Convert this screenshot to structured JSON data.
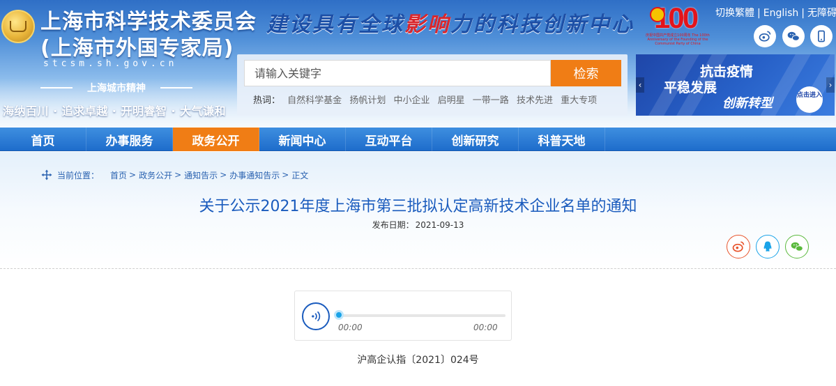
{
  "header": {
    "site_title": "上海市科学技术委员会",
    "site_subtitle": "(上海市外国专家局)",
    "domain": "stcsm.sh.gov.cn",
    "spirit_label": "上海城市精神",
    "spirit_text": "海纳百川 · 追求卓越 · 开明睿智 · 大气谦和",
    "slogan_a": "建设具有全球",
    "slogan_hl": "影响",
    "slogan_b": "力的科技创新中心",
    "anniversary_number": "100",
    "anniversary_caption": "庆祝中国共产党成立100周年 The 100th Anniversary of the Founding of the Communist Party of China",
    "top_links": [
      "切换繁體",
      "English",
      "无障碍"
    ],
    "social_icons": [
      "weibo-icon",
      "wechat-icon"
    ]
  },
  "search": {
    "placeholder": "请输入关键字",
    "button_label": "检索",
    "hot_label": "热词：",
    "hot_terms": [
      "自然科学基金",
      "扬帆计划",
      "中小企业",
      "启明星",
      "一带一路",
      "技术先进",
      "重大专项"
    ]
  },
  "banner": {
    "line1": "抗击疫情",
    "line2": "平稳发展",
    "line3": "创新转型",
    "enter_label": "点击进入"
  },
  "nav": {
    "items": [
      {
        "label": "首页",
        "active": false
      },
      {
        "label": "办事服务",
        "active": false
      },
      {
        "label": "政务公开",
        "active": true
      },
      {
        "label": "新闻中心",
        "active": false
      },
      {
        "label": "互动平台",
        "active": false
      },
      {
        "label": "创新研究",
        "active": false
      },
      {
        "label": "科普天地",
        "active": false
      }
    ]
  },
  "breadcrumb": {
    "label": "当前位置：",
    "items": [
      "首页",
      "政务公开",
      "通知告示",
      "办事通知告示",
      "正文"
    ]
  },
  "article": {
    "title": "关于公示2021年度上海市第三批拟认定高新技术企业名单的通知",
    "date_label": "发布日期：",
    "date": "2021-09-13",
    "doc_number": "沪高企认指〔2021〕024号"
  },
  "share": {
    "icons": [
      "weibo-icon",
      "qq-icon",
      "wechat-icon"
    ],
    "colors": {
      "weibo": "#e8542c",
      "qq": "#1aa3e8",
      "wechat": "#5ab93d"
    }
  },
  "audio": {
    "current_time": "00:00",
    "duration": "00:00",
    "progress": 0
  },
  "colors": {
    "accent_orange": "#f07d15",
    "nav_blue": "#1e6ccb",
    "title_blue": "#1a5bbd"
  }
}
